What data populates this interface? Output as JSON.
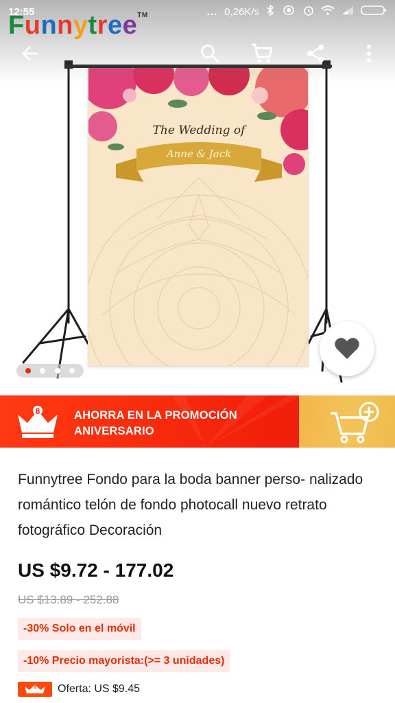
{
  "status_bar": {
    "time": "12:55",
    "overflow": "...",
    "network_speed": "0,26K/s"
  },
  "brand": {
    "name_parts": [
      "F",
      "u",
      "n",
      "n",
      "y",
      "t",
      "r",
      "e",
      "e"
    ],
    "tm": "TM"
  },
  "brand_colors": [
    "#1a8a3a",
    "#e63a2e",
    "#1a6ec2",
    "#e63a2e",
    "#f0a020",
    "#1a8a3a",
    "#e63a2e",
    "#1a6ec2",
    "#7a3aa0"
  ],
  "appbar": {
    "icons": [
      "back-arrow-icon",
      "search-icon",
      "cart-icon",
      "share-icon",
      "more-vert-icon"
    ]
  },
  "backdrop": {
    "line1": "The Wedding of",
    "line2": "Anne & Jack"
  },
  "pager": {
    "count": 4,
    "active": 0
  },
  "promo": {
    "line1": "AHORRA EN LA PROMOCIÓN",
    "line2": "ANIVERSARIO",
    "crown_number": "8"
  },
  "product": {
    "title": "Funnytree Fondo para la boda banner perso- nalizado romántico telón de fondo photocall nuevo retrato fotográfico Decoración",
    "price": "US $9.72 - 177.02",
    "old_price": "US $13.89 - 252.88",
    "tags": [
      "-30%  Solo en el móvil",
      "-10%  Precio mayorista:(>= 3 unidades)"
    ],
    "offer": "Oferta: US $9.45",
    "offer_badge_number": "8"
  },
  "colors": {
    "accent": "#e62e04",
    "promo_bg": "#f21f0a",
    "promo_cta": "#f2c35a",
    "tag_bg": "#fde9e7"
  }
}
